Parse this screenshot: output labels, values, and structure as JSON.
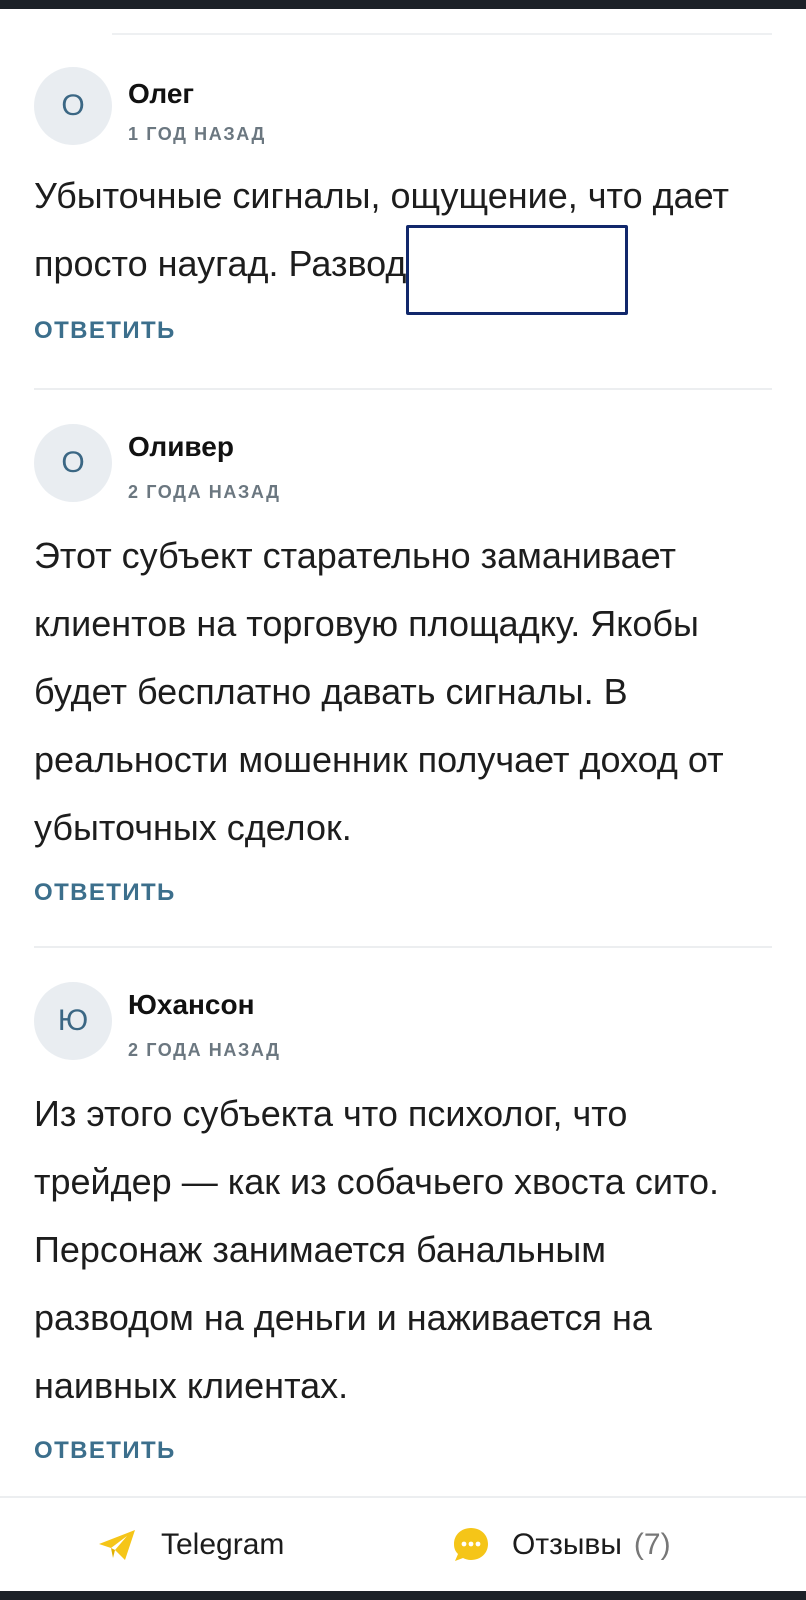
{
  "comments": [
    {
      "avatar_letter": "О",
      "author": "Олег",
      "time": "1 год назад",
      "text": "Убыточные сигналы, ощущение, что дает просто наугад. Развод",
      "reply_label": "Ответить"
    },
    {
      "avatar_letter": "О",
      "author": "Оливер",
      "time": "2 года назад",
      "text": "Этот субъект старательно заманивает клиентов на торговую площадку. Якобы будет бесплатно давать сигналы. В реальности мошенник получает доход от убыточных сделок.",
      "reply_label": "Ответить"
    },
    {
      "avatar_letter": "Ю",
      "author": "Юхансон",
      "time": "2 года назад",
      "text": "Из этого субъекта что психолог, что трейдер — как из собачьего хвоста сито. Персонаж занимается банальным разводом на деньги и наживается на наивных клиентах.",
      "reply_label": "Ответить"
    }
  ],
  "bottom_bar": {
    "telegram_label": "Telegram",
    "telegram_icon": "telegram-plane-icon",
    "reviews_label": "Отзывы",
    "reviews_count": "(7)",
    "reviews_icon": "chat-bubble-icon"
  },
  "colors": {
    "accent": "#3c6f8c",
    "highlight_border": "#11286b",
    "icon_yellow": "#f5c518"
  }
}
